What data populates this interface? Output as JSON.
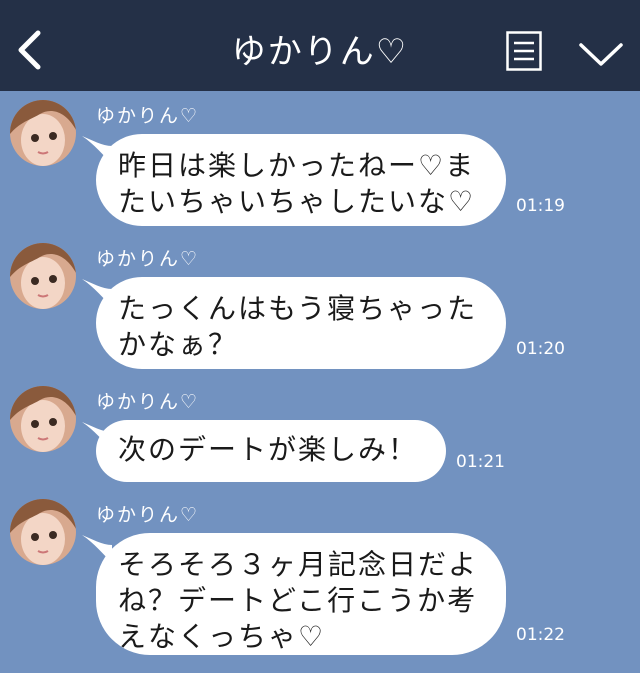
{
  "header": {
    "title": "ゆかりん♡",
    "back_icon": "chevron-left-icon",
    "menu_icon": "menu-list-icon",
    "more_icon": "chevron-down-icon"
  },
  "messages": [
    {
      "sender": "ゆかりん♡",
      "text": "昨日は楽しかったねー♡ま\nたいちゃいちゃしたいな♡",
      "time": "01:19"
    },
    {
      "sender": "ゆかりん♡",
      "text": "たっくんはもう寝ちゃった\nかなぁ？",
      "time": "01:20"
    },
    {
      "sender": "ゆかりん♡",
      "text": "次のデートが楽しみ！",
      "time": "01:21"
    },
    {
      "sender": "ゆかりん♡",
      "text": "そろそろ３ヶ月記念日だよ\nね？デートどこ行こうか考\nえなくっちゃ♡",
      "time": "01:22"
    }
  ],
  "colors": {
    "header_bg": "#243047",
    "chat_bg": "#7292c0",
    "bubble_bg": "#ffffff"
  }
}
